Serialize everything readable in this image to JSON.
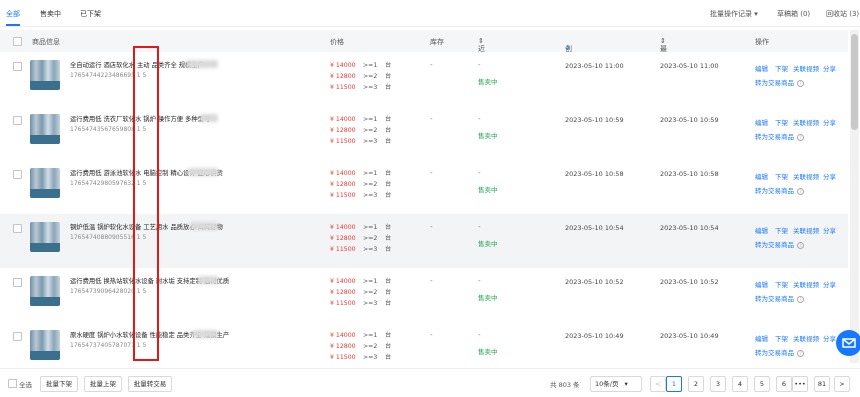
{
  "tabs": [
    "全部",
    "售卖中",
    "已下架"
  ],
  "toolbar": {
    "batch_record": "批量操作记录",
    "draft": "草稿箱 (0)",
    "recycle": "回收站 (3)"
  },
  "columns": {
    "product": "商品信息",
    "price": "价格",
    "stock": "库存",
    "exposure": "近30日曝光",
    "created": "创建时间",
    "updated": "最新操作时间",
    "actions": "操作"
  },
  "price_tiers": [
    {
      "price": "¥ 14000",
      "qty": ">=1",
      "unit": "台"
    },
    {
      "price": "¥ 12800",
      "qty": ">=2",
      "unit": "台"
    },
    {
      "price": "¥ 11500",
      "qty": ">=3",
      "unit": "台"
    }
  ],
  "row_common": {
    "stock": "-",
    "exposure_dash": "-",
    "status": "售卖中"
  },
  "row_actions": {
    "edit": "编辑",
    "delist": "下架",
    "video": "关联视频",
    "share": "分享",
    "convert": "转为交易商品"
  },
  "rows": [
    {
      "title": "全自动运行 酒店软化水 主动 品类齐全 规模生产",
      "id": "17654744223486695 1 5",
      "created": "2023-05-10 11:00",
      "updated": "2023-05-10 11:00"
    },
    {
      "title": "运行费用低 洗衣厂软化水 锅炉 操作方便 多种型号",
      "id": "17654743567659808 1 5",
      "created": "2023-05-10 10:59",
      "updated": "2023-05-10 10:59"
    },
    {
      "title": "运行费用低 游泳池软化水 电脑控制 精心设计 匠心供货",
      "id": "17654742980597632 1 5",
      "created": "2023-05-10 10:58",
      "updated": "2023-05-10 10:58"
    },
    {
      "title": "钢炉低温 锅炉软化水设备 工艺用水 品质放心 口碑好物",
      "id": "17654740880905516 1 5",
      "created": "2023-05-10 10:54",
      "updated": "2023-05-10 10:54"
    },
    {
      "title": "运行费用低 换热站软化水设备 耐水垢 支持定制 选材优质",
      "id": "17654739096428020 1 5",
      "created": "2023-05-10 10:52",
      "updated": "2023-05-10 10:52"
    },
    {
      "title": "原水硬度 锅炉小水软化设备 性能稳定 品类齐全 规模生产",
      "id": "17654737405787071 1 5",
      "created": "2023-05-10 10:49",
      "updated": "2023-05-10 10:49"
    }
  ],
  "footer": {
    "select_all": "全选",
    "batch_delist": "批量下架",
    "batch_list": "批量上架",
    "batch_convert": "批量转交易",
    "total": "共 803 条",
    "page_size": "10条/页",
    "pages": [
      "1",
      "2",
      "3",
      "4",
      "5",
      "6",
      "•••",
      "81"
    ],
    "prev": "<",
    "next": ">"
  },
  "colors": {
    "accent": "#1677ff",
    "price": "#e53935",
    "status": "#1ea54b",
    "highlight_box": "#e01a1a"
  }
}
